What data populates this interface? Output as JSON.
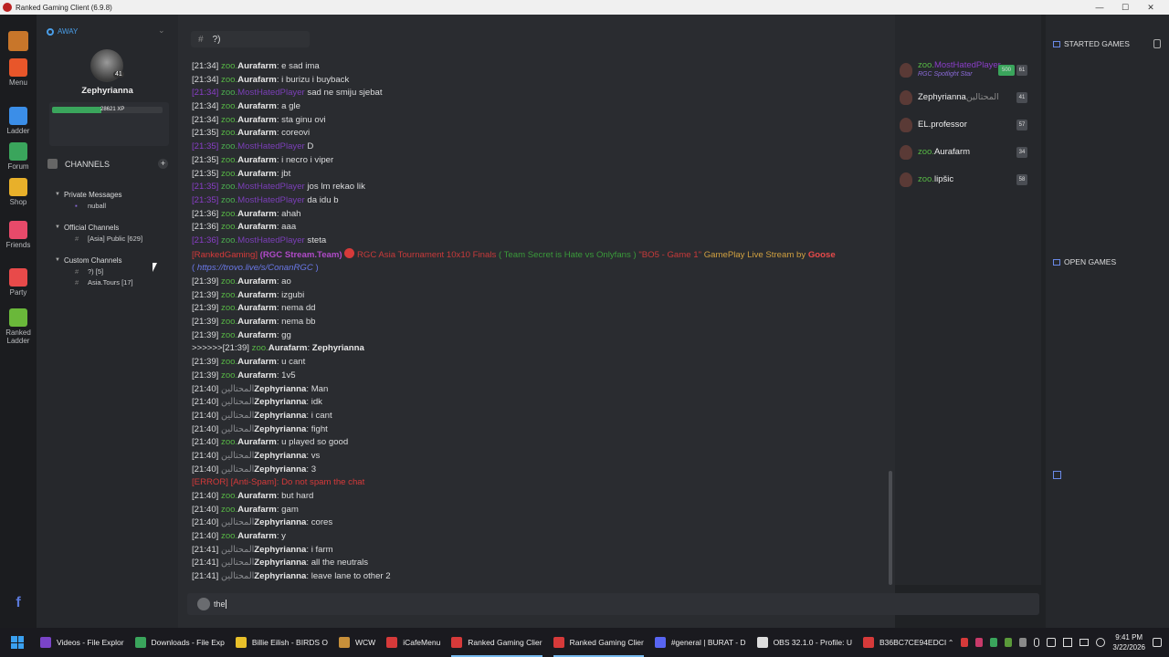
{
  "window": {
    "title": "Ranked Gaming Client (6.9.8)"
  },
  "leftbar": {
    "items": [
      {
        "label": "Menu",
        "icon": "gear-icon",
        "color": "#e8562a"
      },
      {
        "label": "Ladder",
        "icon": "bar-chart-icon",
        "color": "#3b8ee8"
      },
      {
        "label": "Forum",
        "icon": "forum-icon",
        "color": "#3aa55c"
      },
      {
        "label": "Shop",
        "icon": "coins-icon",
        "color": "#e8b02a"
      },
      {
        "label": "Friends",
        "icon": "friends-icon",
        "color": "#e84a6a"
      },
      {
        "label": "Party",
        "icon": "swords-icon",
        "color": "#e84a4a"
      },
      {
        "label": "Ranked Ladder",
        "icon": "ranked-ladder-icon",
        "color": "#6ab83a"
      }
    ]
  },
  "user": {
    "status": "AWAY",
    "name": "Zephyrianna",
    "level": "41",
    "xp": "28621 XP",
    "xp_fraction": 0.45
  },
  "channels": {
    "header": "CHANNELS",
    "groups": [
      {
        "title": "Private Messages",
        "items": [
          "nuball"
        ]
      },
      {
        "title": "Official Channels",
        "items": [
          "[Asia] Public [629]"
        ]
      },
      {
        "title": "Custom Channels",
        "items": [
          "?) [5]",
          "Asia.Tours [17]"
        ]
      }
    ]
  },
  "chat": {
    "channel": "?)",
    "input": "the",
    "lines": [
      {
        "t": "n",
        "ts": "[21:34]",
        "p": "zoo.",
        "n": "Aurafarm",
        "m": "e sad ima"
      },
      {
        "t": "n",
        "ts": "[21:34]",
        "p": "zoo.",
        "n": "Aurafarm",
        "m": "i burizu i buyback"
      },
      {
        "t": "p",
        "ts": "[21:34]",
        "p": "zoo.",
        "n": "MostHatedPlayer",
        "m": "sad ne smiju sjebat"
      },
      {
        "t": "n",
        "ts": "[21:34]",
        "p": "zoo.",
        "n": "Aurafarm",
        "m": "a gle"
      },
      {
        "t": "n",
        "ts": "[21:34]",
        "p": "zoo.",
        "n": "Aurafarm",
        "m": "sta ginu ovi"
      },
      {
        "t": "n",
        "ts": "[21:35]",
        "p": "zoo.",
        "n": "Aurafarm",
        "m": "coreovi"
      },
      {
        "t": "p",
        "ts": "[21:35]",
        "p": "zoo.",
        "n": "MostHatedPlayer",
        "m": "D"
      },
      {
        "t": "n",
        "ts": "[21:35]",
        "p": "zoo.",
        "n": "Aurafarm",
        "m": "i necro i viper"
      },
      {
        "t": "n",
        "ts": "[21:35]",
        "p": "zoo.",
        "n": "Aurafarm",
        "m": "jbt"
      },
      {
        "t": "p",
        "ts": "[21:35]",
        "p": "zoo.",
        "n": "MostHatedPlayer",
        "m": "jos lm rekao lik"
      },
      {
        "t": "p",
        "ts": "[21:35]",
        "p": "zoo.",
        "n": "MostHatedPlayer",
        "m": "da idu b"
      },
      {
        "t": "n",
        "ts": "[21:36]",
        "p": "zoo.",
        "n": "Aurafarm",
        "m": "ahah"
      },
      {
        "t": "n",
        "ts": "[21:36]",
        "p": "zoo.",
        "n": "Aurafarm",
        "m": "aaa"
      },
      {
        "t": "p",
        "ts": "[21:36]",
        "p": "zoo.",
        "n": "MostHatedPlayer",
        "m": "steta"
      },
      {
        "t": "s",
        "a": "[RankedGaming]",
        "b": "(RGC Stream.Team)",
        "c": "RGC Asia Tournament 10x10 Finals",
        "d": "( Team Secret is Hate vs Onlyfans )",
        "e": "\"BO5 - Game 1\"",
        "f": "GamePlay Live Stream by",
        "g": "Goose"
      },
      {
        "t": "l",
        "a": "( ",
        "b": "https://trovo.live/s/ConanRGC",
        "c": " )"
      },
      {
        "t": "n",
        "ts": "[21:39]",
        "p": "zoo.",
        "n": "Aurafarm",
        "m": "ao"
      },
      {
        "t": "n",
        "ts": "[21:39]",
        "p": "zoo.",
        "n": "Aurafarm",
        "m": "izgubi"
      },
      {
        "t": "n",
        "ts": "[21:39]",
        "p": "zoo.",
        "n": "Aurafarm",
        "m": "nema dd"
      },
      {
        "t": "n",
        "ts": "[21:39]",
        "p": "zoo.",
        "n": "Aurafarm",
        "m": "nema bb"
      },
      {
        "t": "n",
        "ts": "[21:39]",
        "p": "zoo.",
        "n": "Aurafarm",
        "m": "gg"
      },
      {
        "t": "w",
        "ts": ">>>>>>[21:39]",
        "p": "zoo.",
        "n": "Aurafarm",
        "m": "Zephyrianna"
      },
      {
        "t": "n",
        "ts": "[21:39]",
        "p": "zoo.",
        "n": "Aurafarm",
        "m": "u cant"
      },
      {
        "t": "n",
        "ts": "[21:39]",
        "p": "zoo.",
        "n": "Aurafarm",
        "m": "1v5"
      },
      {
        "t": "a",
        "ts": "[21:40]",
        "p": "المحتالين",
        "n": "Zephyrianna",
        "m": "Man"
      },
      {
        "t": "a",
        "ts": "[21:40]",
        "p": "المحتالين",
        "n": "Zephyrianna",
        "m": "idk"
      },
      {
        "t": "a",
        "ts": "[21:40]",
        "p": "المحتالين",
        "n": "Zephyrianna",
        "m": "i cant"
      },
      {
        "t": "a",
        "ts": "[21:40]",
        "p": "المحتالين",
        "n": "Zephyrianna",
        "m": "fight"
      },
      {
        "t": "n",
        "ts": "[21:40]",
        "p": "zoo.",
        "n": "Aurafarm",
        "m": "u played so good"
      },
      {
        "t": "a",
        "ts": "[21:40]",
        "p": "المحتالين",
        "n": "Zephyrianna",
        "m": "vs"
      },
      {
        "t": "a",
        "ts": "[21:40]",
        "p": "المحتالين",
        "n": "Zephyrianna",
        "m": "3"
      },
      {
        "t": "e",
        "m": "[ERROR] [Anti-Spam]: Do not spam the chat"
      },
      {
        "t": "n",
        "ts": "[21:40]",
        "p": "zoo.",
        "n": "Aurafarm",
        "m": "but hard"
      },
      {
        "t": "n",
        "ts": "[21:40]",
        "p": "zoo.",
        "n": "Aurafarm",
        "m": "gam"
      },
      {
        "t": "a",
        "ts": "[21:40]",
        "p": "المحتالين",
        "n": "Zephyrianna",
        "m": "cores"
      },
      {
        "t": "n",
        "ts": "[21:40]",
        "p": "zoo.",
        "n": "Aurafarm",
        "m": "y"
      },
      {
        "t": "a",
        "ts": "[21:41]",
        "p": "المحتالين",
        "n": "Zephyrianna",
        "m": "i farm"
      },
      {
        "t": "a",
        "ts": "[21:41]",
        "p": "المحتالين",
        "n": "Zephyrianna",
        "m": "all the neutrals"
      },
      {
        "t": "a",
        "ts": "[21:41]",
        "p": "المحتالين",
        "n": "Zephyrianna",
        "m": "leave lane to other 2"
      }
    ]
  },
  "members": [
    {
      "prefix": "zoo.",
      "name": "MostHatedPlayer",
      "sub": "RGC Spotlight Star",
      "badge": "500",
      "level": "61"
    },
    {
      "prefix": "",
      "name": "Zephyrianna",
      "suffix": "المحتالين",
      "level": "41"
    },
    {
      "prefix": "",
      "name": "EL.professor",
      "level": "57"
    },
    {
      "prefix": "zoo.",
      "name": "Aurafarm",
      "level": "34"
    },
    {
      "prefix": "zoo.",
      "name": "lipšic",
      "level": "58"
    }
  ],
  "games": {
    "started": "STARTED GAMES",
    "open": "OPEN GAMES"
  },
  "taskbar": {
    "items": [
      {
        "label": "Videos - File Explor",
        "color": "#7a44c8"
      },
      {
        "label": "Downloads - File Exp",
        "color": "#3aa55c"
      },
      {
        "label": "Billie Eilish - BIRDS O",
        "color": "#e8c02a"
      },
      {
        "label": "WCW",
        "color": "#c8903a"
      },
      {
        "label": "iCafeMenu",
        "color": "#d63a3a"
      },
      {
        "label": "Ranked Gaming Clier",
        "color": "#d63a3a"
      },
      {
        "label": "Ranked Gaming Clier",
        "color": "#d63a3a"
      },
      {
        "label": "#general | BURAT - D",
        "color": "#5865f2"
      },
      {
        "label": "OBS 32.1.0 - Profile: U",
        "color": "#ddd"
      },
      {
        "label": "B36BC7CE94EDCI",
        "color": "#d63a3a"
      }
    ],
    "time": "9:41 PM",
    "date": "3/22/2026"
  }
}
